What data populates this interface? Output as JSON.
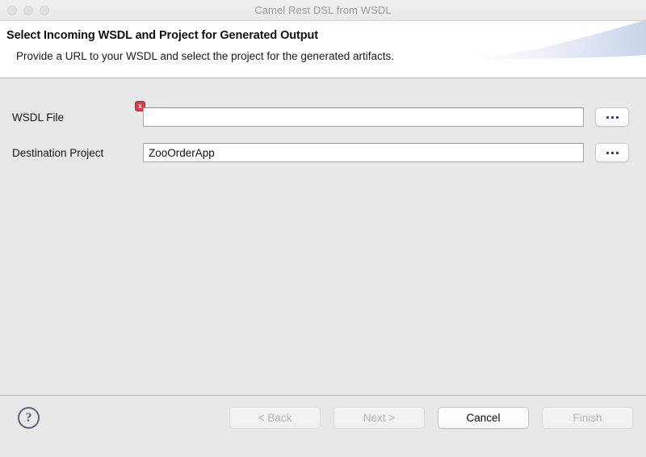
{
  "window": {
    "title": "Camel Rest DSL from WSDL",
    "traffic_lights": [
      "close",
      "minimize",
      "zoom"
    ]
  },
  "header": {
    "title": "Select Incoming WSDL and Project for Generated Output",
    "subtitle": "Provide a URL to your WSDL and select the project for the generated artifacts."
  },
  "form": {
    "wsdl": {
      "label": "WSDL File",
      "value": "",
      "placeholder": "",
      "error_marker": "x",
      "browse_label": "..."
    },
    "project": {
      "label": "Destination Project",
      "value": "ZooOrderApp",
      "placeholder": "",
      "browse_label": "..."
    }
  },
  "footer": {
    "help_label": "?",
    "buttons": [
      {
        "label": "< Back",
        "enabled": false
      },
      {
        "label": "Next >",
        "enabled": false
      },
      {
        "label": "Cancel",
        "enabled": true
      },
      {
        "label": "Finish",
        "enabled": false
      }
    ]
  },
  "colors": {
    "error_red": "#d63c4a",
    "banner_blue": "#c9d4ea",
    "help_slate": "#5a6780",
    "body_grey": "#e8e8e8"
  }
}
